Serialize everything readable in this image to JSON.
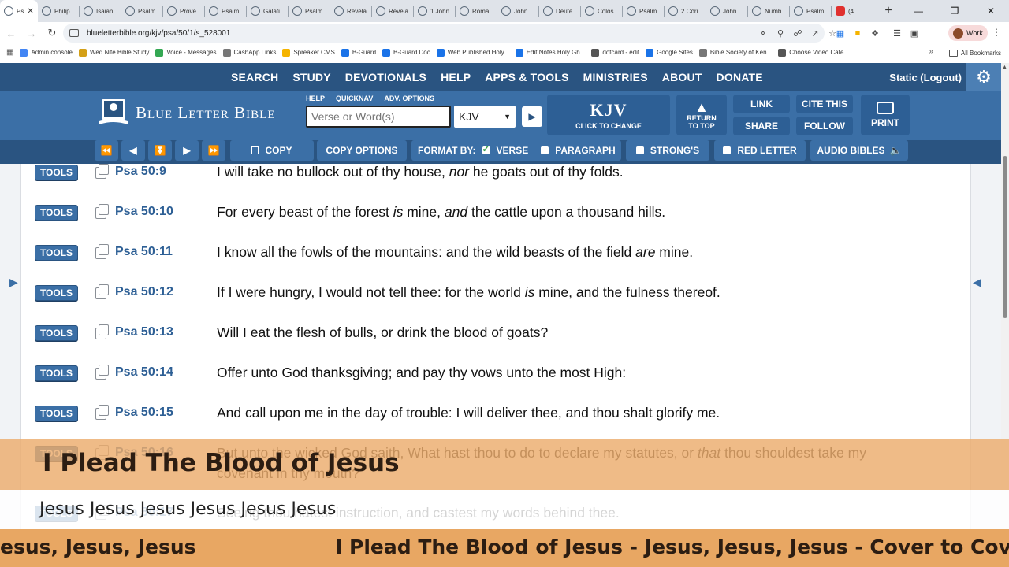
{
  "browser": {
    "tabs": [
      {
        "label": "Ps",
        "active": true
      },
      {
        "label": "Philip"
      },
      {
        "label": "Isaiah"
      },
      {
        "label": "Psalm"
      },
      {
        "label": "Prove"
      },
      {
        "label": "Psalm"
      },
      {
        "label": "Galati"
      },
      {
        "label": "Psalm"
      },
      {
        "label": "Revela"
      },
      {
        "label": "Revela"
      },
      {
        "label": "1 John"
      },
      {
        "label": "Roma"
      },
      {
        "label": "John"
      },
      {
        "label": "Deute"
      },
      {
        "label": "Colos"
      },
      {
        "label": "Psalm"
      },
      {
        "label": "2 Cori"
      },
      {
        "label": "John"
      },
      {
        "label": "Numb"
      },
      {
        "label": "Psalm"
      },
      {
        "label": "(4"
      }
    ],
    "url": "blueletterbible.org/kjv/psa/50/1/s_528001",
    "profile_label": "Work",
    "bookmarks": [
      {
        "label": "Admin console",
        "color": "#4285f4"
      },
      {
        "label": "Wed Nite Bible Study",
        "color": "#d4a017"
      },
      {
        "label": "Voice - Messages",
        "color": "#34a853"
      },
      {
        "label": "CashApp Links",
        "color": "#777777"
      },
      {
        "label": "Spreaker CMS",
        "color": "#f5b400"
      },
      {
        "label": "B-Guard",
        "color": "#1a73e8"
      },
      {
        "label": "B-Guard Doc",
        "color": "#1a73e8"
      },
      {
        "label": "Web Published Holy...",
        "color": "#1a73e8"
      },
      {
        "label": "Edit Notes Holy Gh...",
        "color": "#1a73e8"
      },
      {
        "label": "dotcard - edit",
        "color": "#555555"
      },
      {
        "label": "Google Sites",
        "color": "#1a73e8"
      },
      {
        "label": "Bible Society of Ken...",
        "color": "#777777"
      },
      {
        "label": "Choose Video Cate...",
        "color": "#555555"
      }
    ],
    "all_bookmarks": "All Bookmarks"
  },
  "site": {
    "topnav": [
      "SEARCH",
      "STUDY",
      "DEVOTIONALS",
      "HELP",
      "APPS & TOOLS",
      "MINISTRIES",
      "ABOUT",
      "DONATE"
    ],
    "user_status": "Static (Logout)",
    "logo_text": "Blue Letter Bible",
    "search_links": [
      "HELP",
      "QUICKNAV",
      "ADV. OPTIONS"
    ],
    "search_placeholder": "Verse or Word(s)",
    "version": "KJV",
    "kjv_big": "KJV",
    "kjv_small": "CLICK TO CHANGE",
    "return_top": [
      "RETURN",
      "TO TOP"
    ],
    "link": "LINK",
    "cite": "CITE THIS",
    "share": "SHARE",
    "follow": "FOLLOW",
    "print": "PRINT",
    "toolbar": {
      "copy": "COPY",
      "copy_options": "COPY OPTIONS",
      "format_by": "FORMAT BY:",
      "verse": "VERSE",
      "paragraph": "PARAGRAPH",
      "strongs": "STRONG'S",
      "red_letter": "RED LETTER",
      "audio_bibles": "AUDIO BIBLES"
    }
  },
  "tools_label": "TOOLS",
  "verses": [
    {
      "ref": "Psa 50:9",
      "parts": [
        [
          "I will take no bullock out of thy house, ",
          false
        ],
        [
          "nor",
          true
        ],
        [
          " he goats out of thy folds.",
          false
        ]
      ]
    },
    {
      "ref": "Psa 50:10",
      "parts": [
        [
          "For every beast of the forest ",
          false
        ],
        [
          "is",
          true
        ],
        [
          " mine, ",
          false
        ],
        [
          "and",
          true
        ],
        [
          " the cattle upon a thousand hills.",
          false
        ]
      ]
    },
    {
      "ref": "Psa 50:11",
      "parts": [
        [
          "I know all the fowls of the mountains: and the wild beasts of the field ",
          false
        ],
        [
          "are",
          true
        ],
        [
          " mine.",
          false
        ]
      ]
    },
    {
      "ref": "Psa 50:12",
      "parts": [
        [
          "If I were hungry, I would not tell thee: for the world ",
          false
        ],
        [
          "is",
          true
        ],
        [
          " mine, and the fulness thereof.",
          false
        ]
      ]
    },
    {
      "ref": "Psa 50:13",
      "parts": [
        [
          "Will I eat the flesh of bulls, or drink the blood of goats?",
          false
        ]
      ]
    },
    {
      "ref": "Psa 50:14",
      "parts": [
        [
          "Offer unto God thanksgiving; and pay thy vows unto the most High:",
          false
        ]
      ]
    },
    {
      "ref": "Psa 50:15",
      "parts": [
        [
          "And call upon me in the day of trouble: I will deliver thee, and thou shalt glorify me.",
          false
        ]
      ]
    },
    {
      "ref": "Psa 50:16",
      "parts": [
        [
          "But unto the wicked God saith, What hast thou to do to declare my statutes, or ",
          false
        ],
        [
          "that",
          true
        ],
        [
          " thou shouldest take my covenant in thy mouth?",
          false
        ]
      ]
    },
    {
      "ref": "Psa 50:17",
      "parts": [
        [
          "Seeing thou hatest instruction, and castest my words behind thee.",
          false
        ]
      ]
    }
  ],
  "overlay": {
    "title": "I Plead The Blood of Jesus",
    "subtitle": "Jesus Jesus Jesus Jesus Jesus Jesus",
    "ticker_left": "esus, Jesus, Jesus",
    "ticker_main": "I Plead The Blood of Jesus - Jesus, Jesus, Jesus - Cover to Cover us"
  },
  "colors": {
    "nav_dark": "#2a5481",
    "nav_mid": "#3b6fa6",
    "ref_blue": "#2d5f95",
    "banner_orange": "#e8a763"
  }
}
